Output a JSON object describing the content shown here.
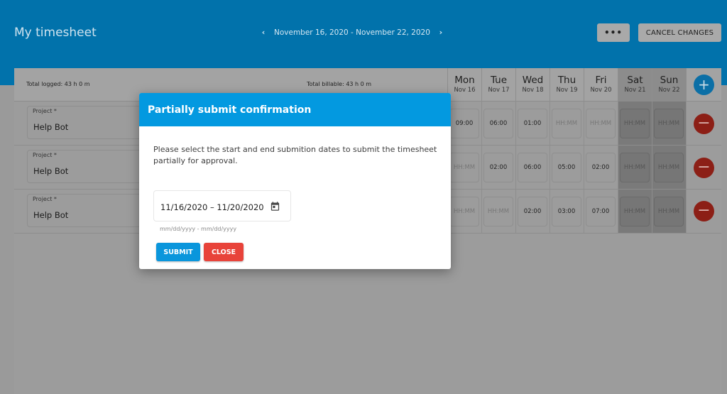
{
  "header": {
    "title": "My timesheet",
    "week_range": "November 16, 2020 - November 22, 2020",
    "prev_icon": "chevron-left-icon",
    "next_icon": "chevron-right-icon",
    "more_label": "•••",
    "cancel_label": "CANCEL CHANGES"
  },
  "summary": {
    "total_logged": "Total logged: 43 h 0 m",
    "total_billable": "Total billable: 43 h 0 m"
  },
  "days": [
    {
      "name": "Mon",
      "date": "Nov 16"
    },
    {
      "name": "Tue",
      "date": "Nov 17"
    },
    {
      "name": "Wed",
      "date": "Nov 18"
    },
    {
      "name": "Thu",
      "date": "Nov 19"
    },
    {
      "name": "Fri",
      "date": "Nov 20"
    },
    {
      "name": "Sat",
      "date": "Nov 21"
    },
    {
      "name": "Sun",
      "date": "Nov 22"
    }
  ],
  "add_icon": "+",
  "remove_icon": "−",
  "rows": [
    {
      "project_label": "Project *",
      "project_value": "Help Bot",
      "hours": [
        "09:00",
        "06:00",
        "01:00",
        "HH:MM",
        "HH:MM",
        "HH:MM",
        "HH:MM"
      ]
    },
    {
      "project_label": "Project *",
      "project_value": "Help Bot",
      "hours": [
        "HH:MM",
        "02:00",
        "06:00",
        "05:00",
        "02:00",
        "HH:MM",
        "HH:MM"
      ]
    },
    {
      "project_label": "Project *",
      "project_value": "Help Bot",
      "hours": [
        "HH:MM",
        "HH:MM",
        "02:00",
        "03:00",
        "07:00",
        "HH:MM",
        "HH:MM"
      ]
    }
  ],
  "modal": {
    "title": "Partially submit confirmation",
    "message": "Please select the start and end submition dates to submit the timesheet partially for approval.",
    "date_range_value": "11/16/2020 – 11/20/2020",
    "date_hint": "mm/dd/yyyy - mm/dd/yyyy",
    "submit_label": "SUBMIT",
    "close_label": "CLOSE"
  },
  "colors": {
    "header_bg": "#0172ab",
    "modal_header": "#0399e0",
    "submit": "#0a96dc",
    "close": "#e8433a"
  }
}
